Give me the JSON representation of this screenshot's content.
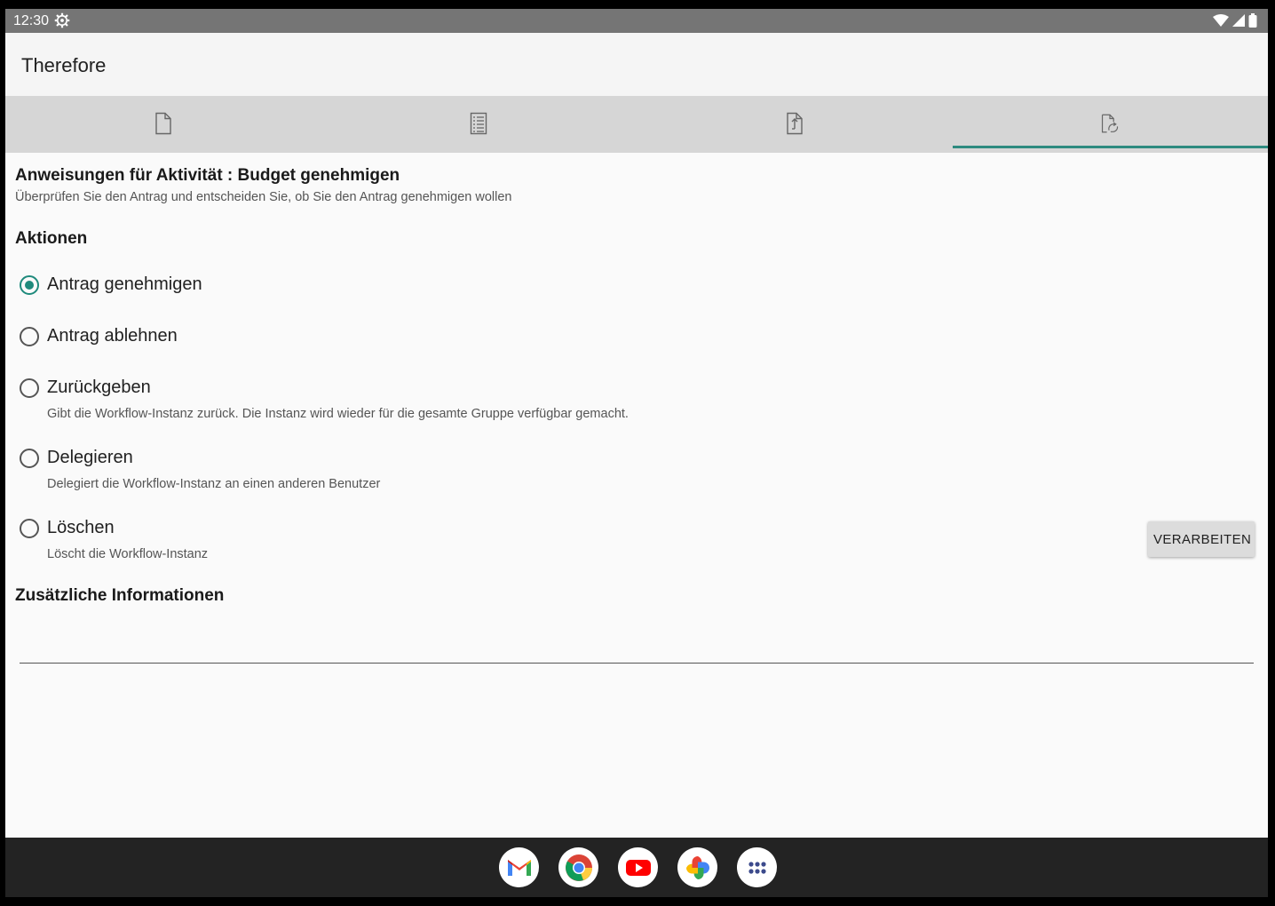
{
  "status_bar": {
    "time": "12:30"
  },
  "app_bar": {
    "title": "Therefore"
  },
  "tabs": [
    {
      "icon": "document-icon",
      "active": false
    },
    {
      "icon": "index-list-icon",
      "active": false
    },
    {
      "icon": "document-version-icon",
      "active": false
    },
    {
      "icon": "workflow-document-icon",
      "active": true
    }
  ],
  "instructions": {
    "title": "Anweisungen für Aktivität : Budget genehmigen",
    "text": "Überprüfen Sie den Antrag und entscheiden Sie, ob Sie den Antrag genehmigen wollen"
  },
  "actions": {
    "heading": "Aktionen",
    "options": [
      {
        "label": "Antrag genehmigen",
        "description": "",
        "checked": true
      },
      {
        "label": "Antrag ablehnen",
        "description": "",
        "checked": false
      },
      {
        "label": "Zurückgeben",
        "description": "Gibt die Workflow-Instanz zurück. Die Instanz wird wieder für die gesamte Gruppe verfügbar gemacht.",
        "checked": false
      },
      {
        "label": "Delegieren",
        "description": "Delegiert die Workflow-Instanz an einen anderen Benutzer",
        "checked": false
      },
      {
        "label": "Löschen",
        "description": "Löscht die Workflow-Instanz",
        "checked": false
      }
    ],
    "process_button": "VERARBEITEN"
  },
  "additional_info": {
    "heading": "Zusätzliche Informationen",
    "value": ""
  },
  "dock": [
    "gmail-icon",
    "chrome-icon",
    "youtube-icon",
    "photos-icon",
    "app-drawer-icon"
  ],
  "colors": {
    "accent": "#1f8a7c",
    "tab_bar": "#d6d6d6",
    "status_bar": "#757575"
  }
}
